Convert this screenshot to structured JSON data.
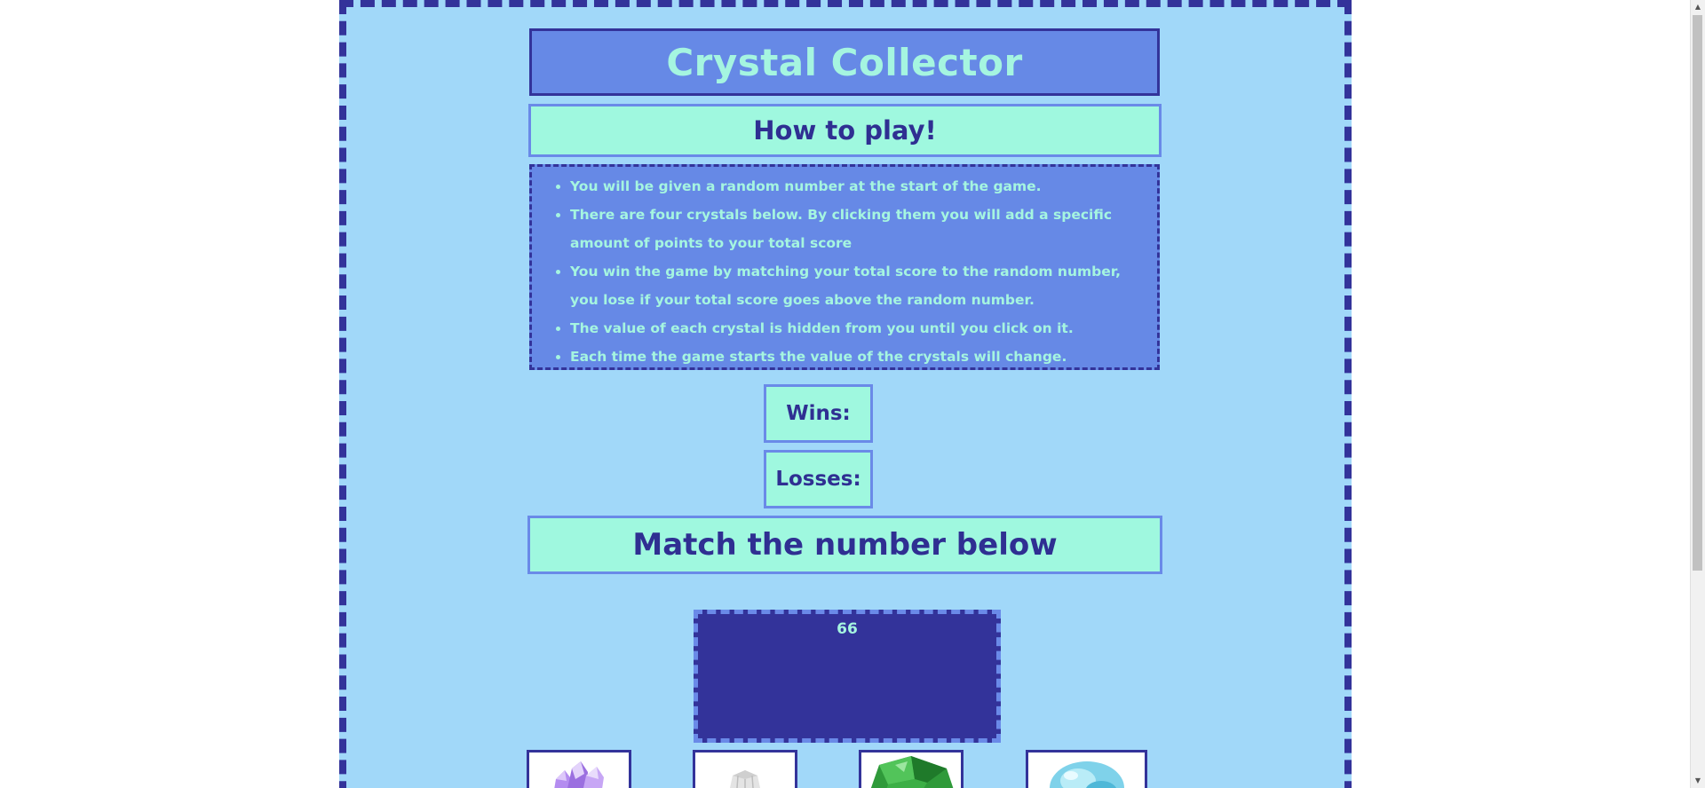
{
  "game": {
    "title": "Crystal Collector",
    "how_to_heading": "How to play!",
    "rules": [
      "You will be given a random number at the start of the game.",
      "There are four crystals below. By clicking them you will add a specific amount of points to your total score",
      "You win the game by matching your total score to the random number, you lose if your total score goes above the random number.",
      "The value of each crystal is hidden from you until you click on it.",
      "Each time the game starts the value of the crystals will change."
    ],
    "wins_label": "Wins:",
    "losses_label": "Losses:",
    "match_heading": "Match the number below",
    "target_number": "66",
    "crystals": [
      {
        "name": "purple-crystal",
        "color": "#9b6fe0"
      },
      {
        "name": "white-crystal",
        "color": "#c9c9c9"
      },
      {
        "name": "green-crystal",
        "color": "#2f9a3a"
      },
      {
        "name": "blue-crystal",
        "color": "#4fb8d8"
      }
    ]
  },
  "colors": {
    "frame_background": "#a1d8f9",
    "frame_border": "#33339a",
    "panel_dark": "#6689e6",
    "panel_light": "#9ff8df",
    "text_light": "#a5f5e0",
    "text_dark": "#2f2f92"
  }
}
